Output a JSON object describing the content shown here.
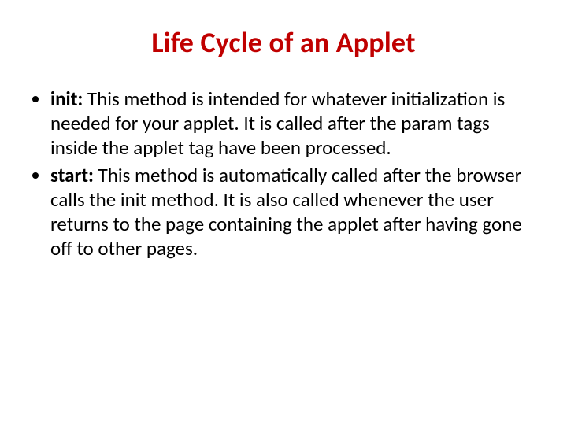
{
  "title": "Life Cycle of an Applet",
  "bullets": [
    {
      "term": "init:",
      "text": " This method is intended for whatever initialization is needed for your applet. It is called after the param tags inside the applet tag have been processed."
    },
    {
      "term": "start:",
      "text": " This method is automatically called after the browser calls the init method. It is also called whenever the user returns to the page containing the applet after having gone off to other pages."
    }
  ]
}
